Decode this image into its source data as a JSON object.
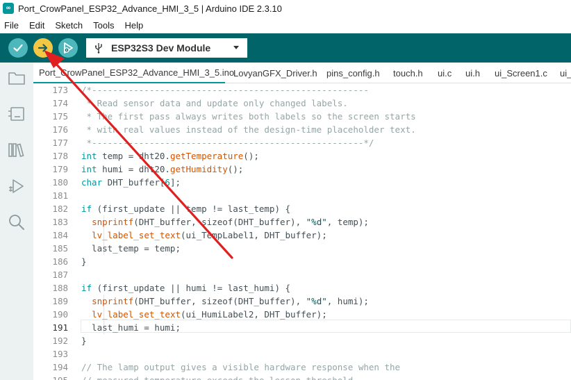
{
  "window": {
    "title": "Port_CrowPanel_ESP32_Advance_HMI_3_5 | Arduino IDE 2.3.10"
  },
  "menu": [
    "File",
    "Edit",
    "Sketch",
    "Tools",
    "Help"
  ],
  "toolbar": {
    "board": "ESP32S3 Dev Module"
  },
  "tabs": [
    {
      "label": "Port_CrowPanel_ESP32_Advance_HMI_3_5.ino",
      "active": true
    },
    {
      "label": "LovyanGFX_Driver.h",
      "active": false
    },
    {
      "label": "pins_config.h",
      "active": false
    },
    {
      "label": "touch.h",
      "active": false
    },
    {
      "label": "ui.c",
      "active": false
    },
    {
      "label": "ui.h",
      "active": false
    },
    {
      "label": "ui_Screen1.c",
      "active": false
    },
    {
      "label": "ui_S",
      "active": false
    }
  ],
  "editor": {
    "current_line": 191,
    "lines": [
      {
        "n": 173,
        "text": "/*-----------------------------------------------------"
      },
      {
        "n": 174,
        "text": " * Read sensor data and update only changed labels."
      },
      {
        "n": 175,
        "text": " * The first pass always writes both labels so the screen starts"
      },
      {
        "n": 176,
        "text": " * with real values instead of the design-time placeholder text."
      },
      {
        "n": 177,
        "text": " *----------------------------------------------------*/"
      },
      {
        "n": 178,
        "text": "int temp = dht20.getTemperature();"
      },
      {
        "n": 179,
        "text": "int humi = dht20.getHumidity();"
      },
      {
        "n": 180,
        "text": "char DHT_buffer[6];"
      },
      {
        "n": 181,
        "text": ""
      },
      {
        "n": 182,
        "text": "if (first_update || temp != last_temp) {"
      },
      {
        "n": 183,
        "text": "  snprintf(DHT_buffer, sizeof(DHT_buffer), \"%d\", temp);"
      },
      {
        "n": 184,
        "text": "  lv_label_set_text(ui_TempLabel1, DHT_buffer);"
      },
      {
        "n": 185,
        "text": "  last_temp = temp;"
      },
      {
        "n": 186,
        "text": "}"
      },
      {
        "n": 187,
        "text": ""
      },
      {
        "n": 188,
        "text": "if (first_update || humi != last_humi) {"
      },
      {
        "n": 189,
        "text": "  snprintf(DHT_buffer, sizeof(DHT_buffer), \"%d\", humi);"
      },
      {
        "n": 190,
        "text": "  lv_label_set_text(ui_HumiLabel2, DHT_buffer);"
      },
      {
        "n": 191,
        "text": "  last_humi = humi;"
      },
      {
        "n": 192,
        "text": "}"
      },
      {
        "n": 193,
        "text": ""
      },
      {
        "n": 194,
        "text": "// The lamp output gives a visible hardware response when the"
      },
      {
        "n": 195,
        "text": "// measured temperature exceeds the lesson threshold"
      }
    ]
  },
  "colors": {
    "toolbar_bg": "#006468",
    "button_teal": "#4db7bb",
    "upload_highlight": "#f2c744",
    "keyword": "#00979d",
    "function": "#d35400",
    "string": "#005c5f",
    "comment": "#95a5a6",
    "annotation_arrow": "#e02020"
  }
}
